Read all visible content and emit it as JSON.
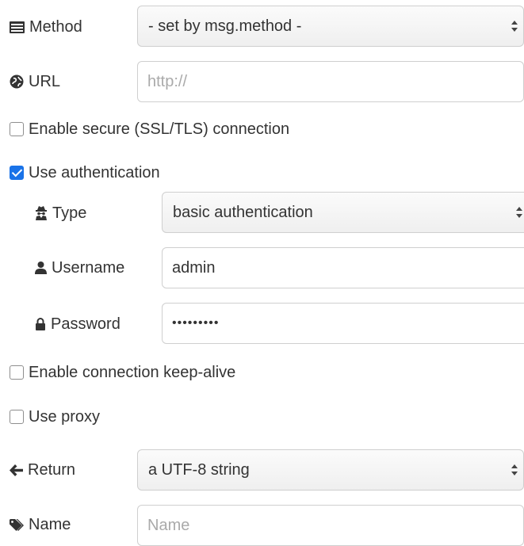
{
  "method": {
    "label": "Method",
    "icon": "list-icon",
    "value": "- set by msg.method -"
  },
  "url": {
    "label": "URL",
    "icon": "globe-icon",
    "value": "",
    "placeholder": "http://"
  },
  "ssl": {
    "label": "Enable secure (SSL/TLS) connection",
    "checked": false
  },
  "auth": {
    "label": "Use authentication",
    "checked": true
  },
  "auth_type": {
    "label": "Type",
    "icon": "user-secret-icon",
    "value": "basic authentication"
  },
  "username": {
    "label": "Username",
    "icon": "user-icon",
    "value": "admin"
  },
  "password": {
    "label": "Password",
    "icon": "lock-icon",
    "value": "•••••••••"
  },
  "keepalive": {
    "label": "Enable connection keep-alive",
    "checked": false
  },
  "proxy": {
    "label": "Use proxy",
    "checked": false
  },
  "return": {
    "label": "Return",
    "icon": "arrow-left-icon",
    "value": "a UTF-8 string"
  },
  "name": {
    "label": "Name",
    "icon": "tag-icon",
    "value": "",
    "placeholder": "Name"
  },
  "colors": {
    "accent": "#1a73e8",
    "text": "#333333",
    "placeholder": "#aaaaaa",
    "border": "#cfcfcf"
  }
}
